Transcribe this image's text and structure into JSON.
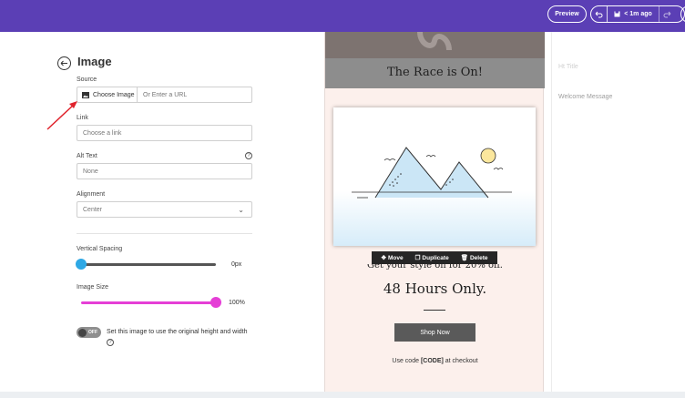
{
  "topbar": {
    "preview_label": "Preview",
    "saved_label": "< 1m ago",
    "colors": {
      "bg": "#5b3fb5"
    }
  },
  "panel": {
    "title": "Image",
    "source_label": "Source",
    "choose_image_label": "Choose Image",
    "url_placeholder": "Or Enter a URL",
    "link_label": "Link",
    "link_value": "Choose a link",
    "alt_label": "Alt Text",
    "alt_value": "None",
    "alignment_label": "Alignment",
    "alignment_value": "Center",
    "vspacing_label": "Vertical Spacing",
    "vspacing_value": "0px",
    "vspacing_fraction": 0.0,
    "imagesize_label": "Image Size",
    "imagesize_value": "100%",
    "imagesize_fraction": 1.0,
    "toggle_state": "OFF",
    "toggle_desc": "Set this image to use the original height and width",
    "colors": {
      "vspacing_thumb": "#2ea8e5",
      "imagesize_accent": "#e53fd6"
    }
  },
  "canvas": {
    "hero_title": "The Race is On!",
    "toolbar": {
      "move": "Move",
      "duplicate": "Duplicate",
      "delete": "Delete"
    },
    "cut_text": "Get your style on for 20% off.",
    "big_text": "48 Hours Only.",
    "shop_label": "Shop Now",
    "code_prefix": "Use code ",
    "code_value": "[CODE]",
    "code_suffix": " at checkout"
  },
  "right_panel": {
    "field_a": "Ht Title",
    "field_b": "Welcome Message"
  }
}
